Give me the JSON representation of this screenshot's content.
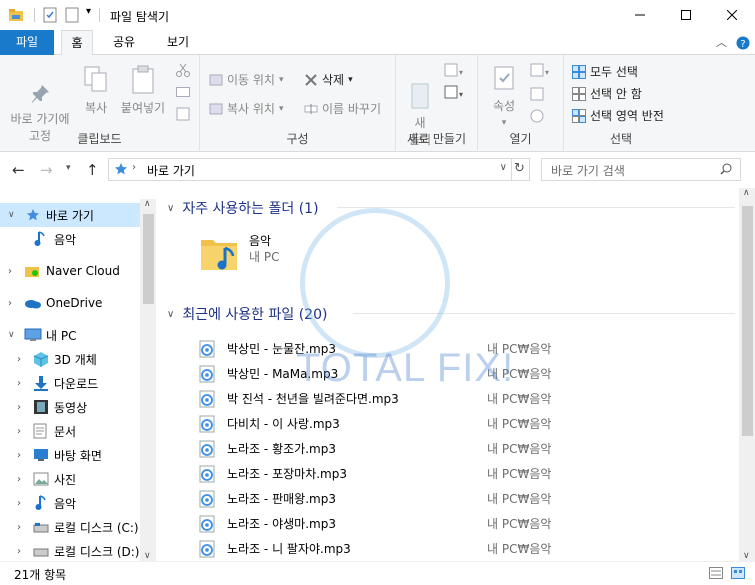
{
  "window": {
    "title": "파일 탐색기"
  },
  "tabs": {
    "file": "파일",
    "home": "홈",
    "share": "공유",
    "view": "보기"
  },
  "ribbon": {
    "clipboard": {
      "label": "클립보드",
      "pin": "바로 가기에\n고정",
      "copy": "복사",
      "paste": "붙여넣기"
    },
    "organize": {
      "label": "구성",
      "move": "이동 위치",
      "copy_to": "복사 위치",
      "delete": "삭제",
      "rename": "이름 바꾸기"
    },
    "new": {
      "label": "새로 만들기",
      "new_folder": "새\n폴더"
    },
    "open": {
      "label": "열기",
      "properties": "속성"
    },
    "select": {
      "label": "선택",
      "select_all": "모두 선택",
      "select_none": "선택 안 함",
      "invert": "선택 영역 반전"
    }
  },
  "address": {
    "path": "바로 가기",
    "search_placeholder": "바로 가기 검색"
  },
  "nav": {
    "items": [
      {
        "label": "바로 가기"
      },
      {
        "label": "음악"
      },
      {
        "label": "Naver Cloud"
      },
      {
        "label": "OneDrive"
      },
      {
        "label": "내 PC"
      },
      {
        "label": "3D 개체"
      },
      {
        "label": "다운로드"
      },
      {
        "label": "동영상"
      },
      {
        "label": "문서"
      },
      {
        "label": "바탕 화면"
      },
      {
        "label": "사진"
      },
      {
        "label": "음악"
      },
      {
        "label": "로컬 디스크 (C:)"
      },
      {
        "label": "로컬 디스크 (D:)"
      }
    ]
  },
  "frequent": {
    "header": "자주 사용하는 폴더 (1)",
    "folder": {
      "name": "음악",
      "location": "내 PC"
    }
  },
  "recent": {
    "header": "최근에 사용한 파일 (20)",
    "files": [
      {
        "name": "박상민 - 눈물잔.mp3",
        "location": "내 PC₩음악"
      },
      {
        "name": "박상민 - MaMa.mp3",
        "location": "내 PC₩음악"
      },
      {
        "name": "박 진석 - 천년을 빌려준다면.mp3",
        "location": "내 PC₩음악"
      },
      {
        "name": "다비치 - 이 사랑.mp3",
        "location": "내 PC₩음악"
      },
      {
        "name": "노라조 - 황조가.mp3",
        "location": "내 PC₩음악"
      },
      {
        "name": "노라조 - 포장마차.mp3",
        "location": "내 PC₩음악"
      },
      {
        "name": "노라조 - 판매왕.mp3",
        "location": "내 PC₩음악"
      },
      {
        "name": "노라조 - 야생마.mp3",
        "location": "내 PC₩음악"
      },
      {
        "name": "노라조 - 니 팔자야.mp3",
        "location": "내 PC₩음악"
      }
    ]
  },
  "status": {
    "count": "21개 항목"
  },
  "watermark": {
    "text": "TOTAL FIX!"
  },
  "colors": {
    "accent": "#1979ca",
    "selection": "#cce8ff",
    "section_header": "#1e3287"
  }
}
